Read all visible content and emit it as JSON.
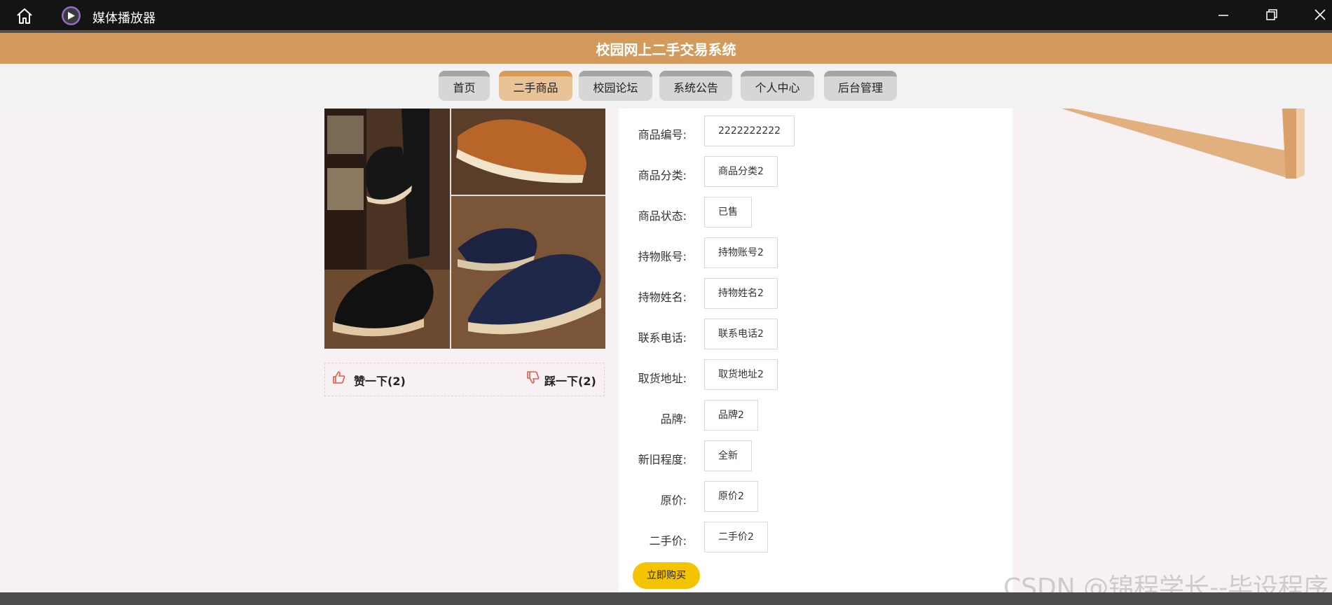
{
  "titlebar": {
    "app_title": "媒体播放器",
    "icons": [
      "home-icon",
      "media-player-icon",
      "minimize-icon",
      "restore-icon",
      "close-icon"
    ]
  },
  "banner": {
    "title": "校园网上二手交易系统"
  },
  "nav": {
    "items": [
      "首页",
      "二手商品",
      "校园论坛",
      "系统公告",
      "个人中心",
      "后台管理"
    ],
    "active": "二手商品"
  },
  "reactions": {
    "like_label": "赞一下(2)",
    "dislike_label": "踩一下(2)"
  },
  "details": {
    "fields": [
      {
        "label": "商品编号:",
        "value": "2222222222"
      },
      {
        "label": "商品分类:",
        "value": "商品分类2"
      },
      {
        "label": "商品状态:",
        "value": "已售"
      },
      {
        "label": "持物账号:",
        "value": "持物账号2"
      },
      {
        "label": "持物姓名:",
        "value": "持物姓名2"
      },
      {
        "label": "联系电话:",
        "value": "联系电话2"
      },
      {
        "label": "取货地址:",
        "value": "取货地址2"
      },
      {
        "label": "品牌:",
        "value": "品牌2"
      },
      {
        "label": "新旧程度:",
        "value": "全新"
      },
      {
        "label": "原价:",
        "value": "原价2"
      },
      {
        "label": "二手价:",
        "value": "二手价2"
      }
    ],
    "buy_label": "立即购买"
  },
  "watermark": "CSDN @锦程学长--毕设程序",
  "colors": {
    "banner": "#d39a5c",
    "nav_active": "#e9c296",
    "buy_button": "#f5c400",
    "page_bg": "#f8f1f4"
  }
}
